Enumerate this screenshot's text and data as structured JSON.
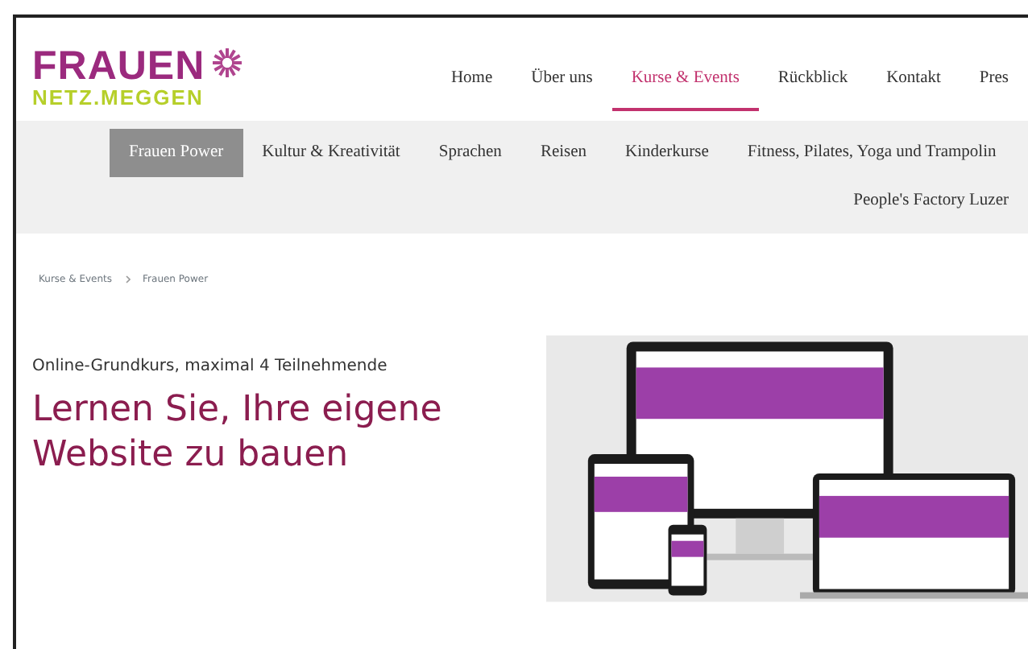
{
  "logo": {
    "title": "FRAUEN",
    "subtitle": "NETZ.MEGGEN"
  },
  "main_nav": [
    {
      "label": "Home",
      "selected": false
    },
    {
      "label": "Über uns",
      "selected": false
    },
    {
      "label": "Kurse & Events",
      "selected": true
    },
    {
      "label": "Rückblick",
      "selected": false
    },
    {
      "label": "Kontakt",
      "selected": false
    },
    {
      "label": "Pres",
      "selected": false
    }
  ],
  "sub_nav": [
    {
      "label": "Frauen Power",
      "selected": true
    },
    {
      "label": "Kultur & Kreativität",
      "selected": false
    },
    {
      "label": "Sprachen",
      "selected": false
    },
    {
      "label": "Reisen",
      "selected": false
    },
    {
      "label": "Kinderkurse",
      "selected": false
    },
    {
      "label": "Fitness, Pilates, Yoga und Trampolin",
      "selected": false
    },
    {
      "label": "People's Factory Luzer",
      "selected": false
    }
  ],
  "breadcrumb": [
    "Kurse & Events",
    "Frauen Power"
  ],
  "intro": {
    "subtitle": "Online-Grundkurs, maximal 4 Teilnehmende",
    "heading": "Lernen Sie, Ihre eigene Website zu bauen"
  }
}
